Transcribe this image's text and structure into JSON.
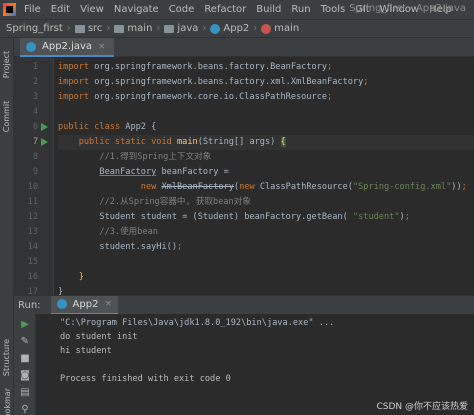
{
  "menubar": {
    "items": [
      "File",
      "Edit",
      "View",
      "Navigate",
      "Code",
      "Refactor",
      "Build",
      "Run",
      "Tools",
      "Git",
      "Window",
      "Help"
    ],
    "window_title": "Spring_first - App2.java"
  },
  "breadcrumb": {
    "project": "Spring_first",
    "src": "src",
    "main": "main",
    "java": "java",
    "class": "App2",
    "method": "main"
  },
  "left_stripe": {
    "project": "Project",
    "commit": "Commit",
    "structure": "Structure",
    "bookmarks": "Bookmarks"
  },
  "editor_tab": {
    "label": "App2.java",
    "close": "×"
  },
  "code_lines": [
    {
      "n": "1",
      "tokens": [
        [
          "kw",
          "import "
        ],
        [
          "id",
          "org.springframework.beans.factory.BeanFactory"
        ],
        [
          "kw",
          ";"
        ]
      ]
    },
    {
      "n": "2",
      "tokens": [
        [
          "kw",
          "import "
        ],
        [
          "id",
          "org.springframework.beans.factory.xml.XmlBeanFactory"
        ],
        [
          "kw",
          ";"
        ]
      ]
    },
    {
      "n": "3",
      "tokens": [
        [
          "kw",
          "import "
        ],
        [
          "id",
          "org.springframework.core.io.ClassPathResource"
        ],
        [
          "kw",
          ";"
        ]
      ]
    },
    {
      "n": "4",
      "tokens": []
    },
    {
      "n": "6",
      "tokens": [
        [
          "kw",
          "public class "
        ],
        [
          "id",
          "App2 {"
        ]
      ]
    },
    {
      "n": "7",
      "tokens": [
        [
          "kw",
          "    public static void "
        ],
        [
          "fn",
          "main"
        ],
        [
          "id",
          "(String[] args) "
        ],
        [
          "bh",
          "{"
        ]
      ]
    },
    {
      "n": "8",
      "tokens": [
        [
          "cmt",
          "        //1.得到Spring上下文对象"
        ]
      ]
    },
    {
      "n": "9",
      "tokens": [
        [
          "id",
          "        "
        ],
        [
          "ul",
          "BeanFactory"
        ],
        [
          "id",
          " beanFactory ="
        ]
      ]
    },
    {
      "n": "10",
      "tokens": [
        [
          "kw",
          "                new "
        ],
        [
          "st",
          "XmlBeanFactory"
        ],
        [
          "id",
          "("
        ],
        [
          "kw",
          "new "
        ],
        [
          "id",
          "ClassPathResource("
        ],
        [
          "str",
          "\"Spring-config.xml\""
        ],
        [
          "id",
          "))"
        ],
        [
          "kw",
          ";"
        ]
      ]
    },
    {
      "n": "11",
      "tokens": [
        [
          "cmt",
          "        //2.从Spring容器中, 获取bean对象"
        ]
      ]
    },
    {
      "n": "12",
      "tokens": [
        [
          "id",
          "        Student student = (Student) beanFactory.getBean( "
        ],
        [
          "str",
          "\"student\""
        ],
        [
          "id",
          ")"
        ],
        [
          "kw",
          ";"
        ]
      ]
    },
    {
      "n": "13",
      "tokens": [
        [
          "cmt",
          "        //3.使用bean"
        ]
      ]
    },
    {
      "n": "14",
      "tokens": [
        [
          "id",
          "        student.sayHi()"
        ],
        [
          "kw",
          ";"
        ]
      ]
    },
    {
      "n": "15",
      "tokens": []
    },
    {
      "n": "16",
      "tokens": [
        [
          "bulb",
          "    }"
        ]
      ]
    },
    {
      "n": "17",
      "tokens": [
        [
          "id",
          "}"
        ]
      ]
    }
  ],
  "run_panel": {
    "title": "Run:",
    "tab_label": "App2",
    "tab_close": "×",
    "output": [
      "\"C:\\Program Files\\Java\\jdk1.8.0_192\\bin\\java.exe\" ...",
      "do student init",
      "hi student",
      "",
      "Process finished with exit code 0"
    ]
  },
  "watermark": "CSDN @你不应该热爱",
  "colors": {
    "accent": "#4a88c7",
    "run_green": "#499c54",
    "keyword": "#cc7832",
    "string": "#6a8759",
    "comment": "#808080",
    "method": "#ffc66d"
  }
}
